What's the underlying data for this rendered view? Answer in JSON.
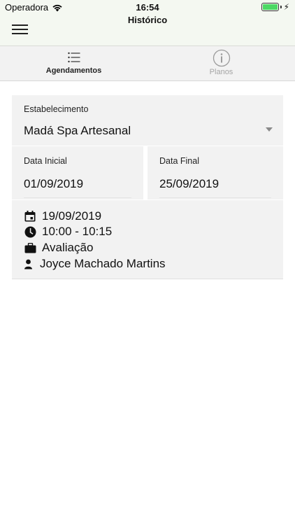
{
  "status_bar": {
    "carrier": "Operadora",
    "time": "16:54",
    "battery_level": 1.0,
    "colors": {
      "battery": "#4cd964"
    }
  },
  "header": {
    "title": "Histórico",
    "menu_icon": "hamburger-menu-icon",
    "background": "#f4f8f1"
  },
  "tabs": [
    {
      "label": "Agendamentos",
      "icon": "list-icon",
      "active": true
    },
    {
      "label": "Planos",
      "icon": "info-icon",
      "active": false
    }
  ],
  "form": {
    "establishment": {
      "label": "Estabelecimento",
      "value": "Madá Spa Artesanal"
    },
    "start_date": {
      "label": "Data Inicial",
      "value": "01/09/2019"
    },
    "end_date": {
      "label": "Data Final",
      "value": "25/09/2019"
    }
  },
  "appointments": [
    {
      "date": "19/09/2019",
      "time": "10:00 - 10:15",
      "service": "Avaliação",
      "professional": "Joyce Machado Martins"
    }
  ]
}
